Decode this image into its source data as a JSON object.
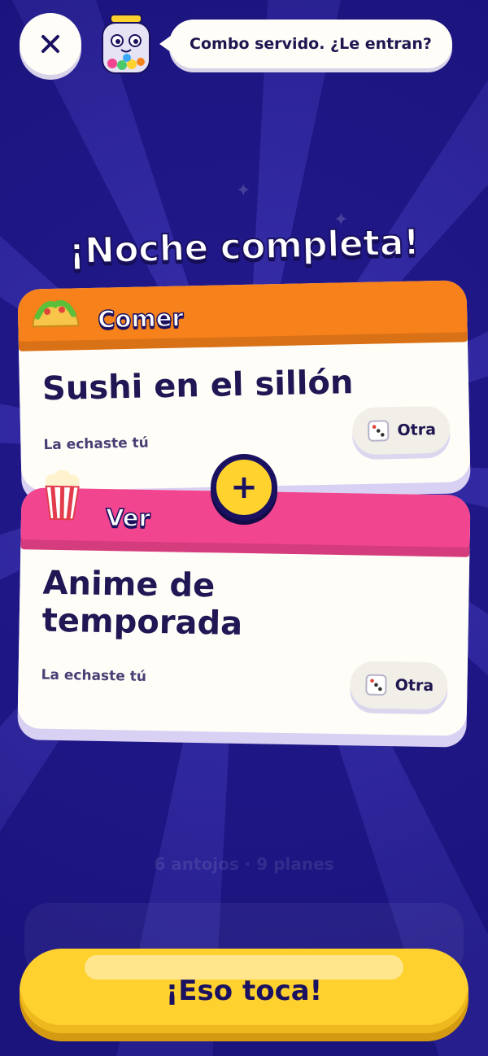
{
  "header": {
    "close_icon": "close-icon",
    "mascot_icon": "gumball-jar-icon",
    "speech": "Combo servido. ¿Le entran?"
  },
  "title": "¡Noche completa!",
  "cards": [
    {
      "category": "Comer",
      "emoji": "taco-icon",
      "color": "#f7811b",
      "pick": "Sushi en el sillón",
      "source": "La echaste tú",
      "reroll_label": "Otra",
      "reroll_icon": "dice-icon"
    },
    {
      "category": "Ver",
      "emoji": "popcorn-icon",
      "color": "#f2458f",
      "pick_line1": "Anime de",
      "pick_line2": "temporada",
      "source": "La echaste tú",
      "reroll_label": "Otra",
      "reroll_icon": "dice-icon"
    }
  ],
  "combine_symbol": "+",
  "background_stats": "6 antojos · 9 planes",
  "cta_label": "¡Eso toca!",
  "colors": {
    "background": "#231a8e",
    "cta": "#ffd12e",
    "ink": "#1a1160"
  }
}
